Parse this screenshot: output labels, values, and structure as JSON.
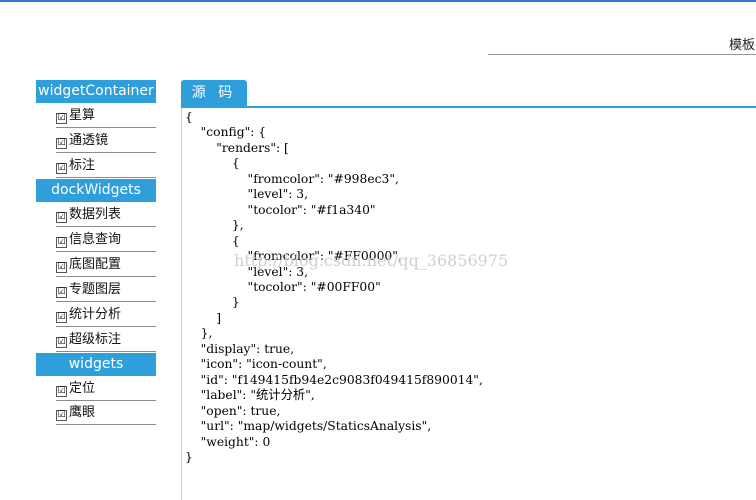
{
  "header": {
    "title": "模板"
  },
  "sidebar": {
    "groups": [
      {
        "label": "widgetContainer",
        "items": [
          "星算",
          "通透镜",
          "标注"
        ]
      },
      {
        "label": "dockWidgets",
        "items": [
          "数据列表",
          "信息查询",
          "底图配置",
          "专题图层",
          "统计分析",
          "超级标注"
        ]
      },
      {
        "label": "widgets",
        "items": [
          "定位",
          "鹰眼"
        ]
      }
    ],
    "checkbox_mark": "☑"
  },
  "tabs": [
    {
      "label": "源 码"
    }
  ],
  "source_code": [
    "{",
    "    \"config\": {",
    "        \"renders\": [",
    "            {",
    "                \"fromcolor\": \"#998ec3\",",
    "                \"level\": 3,",
    "                \"tocolor\": \"#f1a340\"",
    "            },",
    "            {",
    "                \"fromcolor\": \"#FF0000\",",
    "                \"level\": 3,",
    "                \"tocolor\": \"#00FF00\"",
    "            }",
    "        ]",
    "    },",
    "    \"display\": true,",
    "    \"icon\": \"icon-count\",",
    "    \"id\": \"f149415fb94e2c9083f049415f890014\",",
    "    \"label\": \"统计分析\",",
    "    \"open\": true,",
    "    \"url\": \"map/widgets/StaticsAnalysis\",",
    "    \"weight\": 0",
    "}"
  ],
  "watermark": "http://blog.csdn.net/qq_36856975",
  "colors": {
    "accent": "#2f9fdc",
    "top_bar": "#2b7bd0"
  }
}
